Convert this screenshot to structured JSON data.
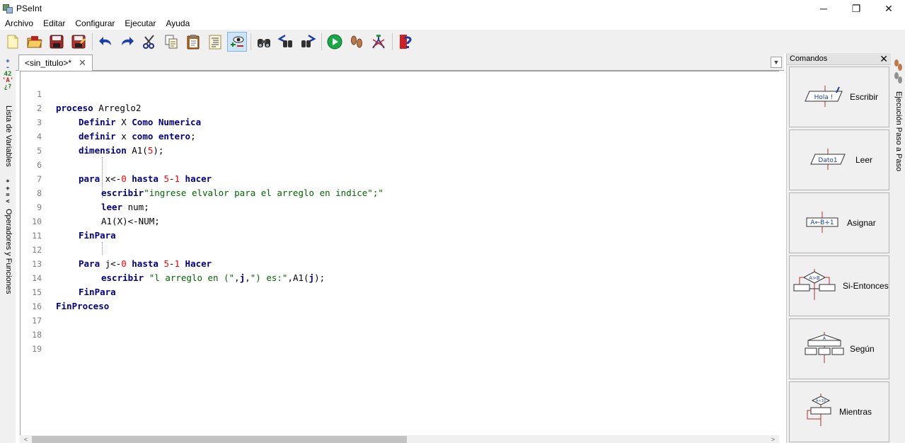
{
  "window": {
    "title": "PSeInt",
    "minimize": "─",
    "maximize": "❐",
    "close": "✕"
  },
  "menu": [
    "Archivo",
    "Editar",
    "Configurar",
    "Ejecutar",
    "Ayuda"
  ],
  "toolbar": {
    "buttons": [
      "new-file-icon",
      "open-folder-icon",
      "save-icon",
      "save-as-icon",
      "undo-icon",
      "redo-icon",
      "cut-icon",
      "copy-icon",
      "paste-icon",
      "format-icon",
      "variables-view-icon",
      "search-icon",
      "find-prev-icon",
      "find-next-icon",
      "run-icon",
      "step-by-step-icon",
      "flowchart-icon",
      "help-icon"
    ]
  },
  "left_tabs": {
    "variables_label": "Lista de Variables",
    "variables_glyph": "+-*A'42",
    "operators_label": "Operadores y Funciones",
    "operators_glyph": "*+=<"
  },
  "editor_tab": {
    "title": "<sin_titulo>*",
    "close": "✕"
  },
  "code_lines": [
    {
      "n": "1"
    },
    {
      "n": "2"
    },
    {
      "n": "3"
    },
    {
      "n": "4"
    },
    {
      "n": "5"
    },
    {
      "n": "6"
    },
    {
      "n": "7"
    },
    {
      "n": "8"
    },
    {
      "n": "9"
    },
    {
      "n": "10"
    },
    {
      "n": "11"
    },
    {
      "n": "12"
    },
    {
      "n": "13"
    },
    {
      "n": "14"
    },
    {
      "n": "15"
    },
    {
      "n": "16"
    },
    {
      "n": "17"
    },
    {
      "n": "18"
    },
    {
      "n": "19"
    }
  ],
  "code": {
    "l1": {
      "kw": "proceso",
      "rest": " Arreglo2"
    },
    "l2": {
      "kw1": "Definir",
      "mid": " X ",
      "kw2": "Como Numerica"
    },
    "l3": {
      "kw1": "definir",
      "mid": " x ",
      "kw2": "como entero",
      "end": ";"
    },
    "l4": {
      "kw": "dimension",
      "pre": " A1(",
      "num": "5",
      "post": ");"
    },
    "l6": {
      "kw1": "para",
      "a": " x<-",
      "n0": "0",
      "kw2": " hasta ",
      "n5": "5",
      "dash": "-",
      "n1": "1",
      "kw3": " hacer"
    },
    "l7": {
      "kw": "escribir",
      "str": "\"ingrese elvalor para el arreglo en indice\";\""
    },
    "l8": {
      "kw": "leer",
      "rest": " num;"
    },
    "l9": {
      "rest": "A1(X)<-NUM;"
    },
    "l10": {
      "kw": "FinPara"
    },
    "l12": {
      "kw1": "Para",
      "a": " j<-",
      "n0": "0",
      "kw2": " hasta ",
      "n5": "5",
      "dash": "-",
      "n1": "1",
      "kw3": " Hacer"
    },
    "l13": {
      "kw": "escribir",
      "s1": " \"l arreglo en (\"",
      "c1": ",",
      "j1": "j",
      "c2": ",",
      "s2": "\") es:\"",
      "c3": ",A1(",
      "j2": "j",
      "end": ");"
    },
    "l14": {
      "kw": "FinPara"
    },
    "l15": {
      "kw": "FinProceso"
    }
  },
  "commands_panel": {
    "title": "Comandos",
    "close": "✕",
    "items": [
      {
        "label": "Escribir",
        "glyph": "Hola !"
      },
      {
        "label": "Leer",
        "glyph": "Dato1"
      },
      {
        "label": "Asignar",
        "glyph": "A←B+1"
      },
      {
        "label": "Si-Entonces",
        "glyph": "A>B"
      },
      {
        "label": "Según",
        "glyph": "A"
      },
      {
        "label": "Mientras",
        "glyph": "A<10"
      }
    ]
  },
  "right_panel": {
    "label": "Ejecución Paso a Paso"
  },
  "colors": {
    "keyword": "#000080",
    "number": "#ff0000",
    "string": "#006400",
    "line_number": "#7f7f7f"
  }
}
